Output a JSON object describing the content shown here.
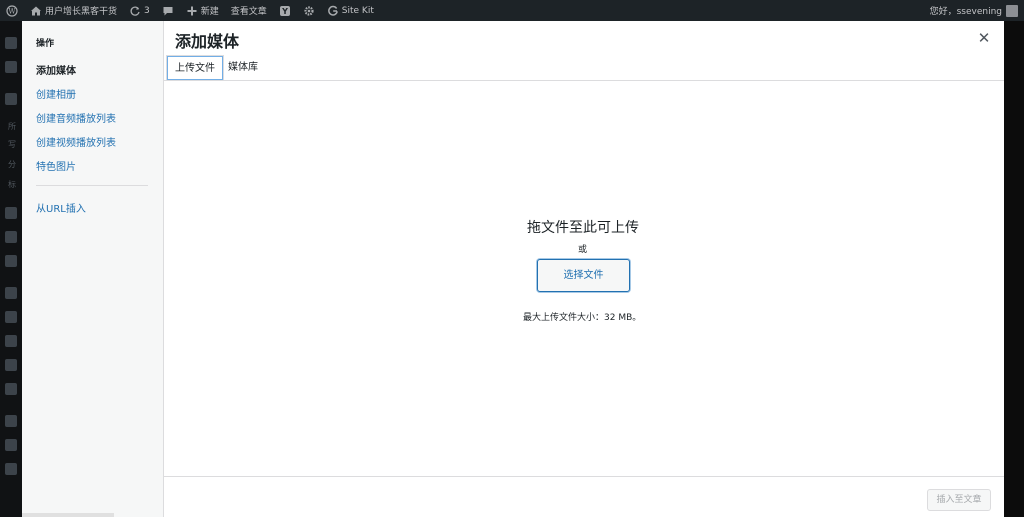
{
  "adminbar": {
    "site_name": "用户增长黑客干货",
    "updates_count": "3",
    "new_label": "新建",
    "view_post_label": "查看文章",
    "sitekit_label": "Site Kit",
    "greeting": "您好，ssevening"
  },
  "modal": {
    "title": "添加媒体",
    "close_icon": "close-icon",
    "menu": {
      "heading": "操作",
      "items": [
        {
          "label": "添加媒体"
        },
        {
          "label": "创建相册"
        },
        {
          "label": "创建音频播放列表"
        },
        {
          "label": "创建视频播放列表"
        },
        {
          "label": "特色图片"
        },
        {
          "label": "从URL插入"
        }
      ]
    },
    "tabs": [
      {
        "label": "上传文件"
      },
      {
        "label": "媒体库"
      }
    ],
    "uploader": {
      "title": "拖文件至此可上传",
      "or": "或",
      "select_button": "选择文件",
      "max_size": "最大上传文件大小：32 MB。"
    },
    "insert_button": "插入至文章"
  },
  "background_sidebar": {
    "text_fragments": [
      "所",
      "写",
      "分",
      "标"
    ]
  },
  "colors": {
    "adminbar_bg": "#1d2327",
    "link": "#2271b1",
    "text": "#1d2327"
  }
}
